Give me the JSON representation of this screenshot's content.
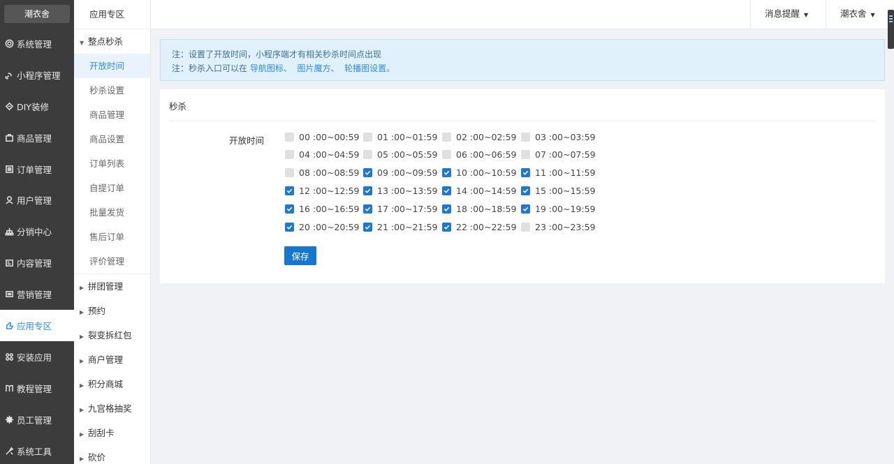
{
  "brand": "潮衣舍",
  "left_nav": [
    {
      "label": "系统管理",
      "icon": "gear-icon",
      "active": false
    },
    {
      "label": "小程序管理",
      "icon": "link-icon",
      "active": false
    },
    {
      "label": "DIY装修",
      "icon": "brush-icon",
      "active": false
    },
    {
      "label": "商品管理",
      "icon": "bag-icon",
      "active": false
    },
    {
      "label": "订单管理",
      "icon": "list-icon",
      "active": false
    },
    {
      "label": "用户管理",
      "icon": "user-icon",
      "active": false
    },
    {
      "label": "分销中心",
      "icon": "tree-icon",
      "active": false
    },
    {
      "label": "内容管理",
      "icon": "doc-icon",
      "active": false
    },
    {
      "label": "营销管理",
      "icon": "ticket-icon",
      "active": false
    },
    {
      "label": "应用专区",
      "icon": "hand-icon",
      "active": true
    },
    {
      "label": "安装应用",
      "icon": "grid-icon",
      "active": false
    },
    {
      "label": "教程管理",
      "icon": "book-icon",
      "active": false
    },
    {
      "label": "员工管理",
      "icon": "cog-icon",
      "active": false
    },
    {
      "label": "系统工具",
      "icon": "tool-icon",
      "active": false
    }
  ],
  "sub_nav": {
    "title": "应用专区",
    "open_group": "整点秒杀",
    "open_items": [
      {
        "label": "开放时间",
        "active": true
      },
      {
        "label": "秒杀设置",
        "active": false
      },
      {
        "label": "商品管理",
        "active": false
      },
      {
        "label": "商品设置",
        "active": false
      },
      {
        "label": "订单列表",
        "active": false
      },
      {
        "label": "自提订单",
        "active": false
      },
      {
        "label": "批量发货",
        "active": false
      },
      {
        "label": "售后订单",
        "active": false
      },
      {
        "label": "评价管理",
        "active": false
      }
    ],
    "collapsed_groups": [
      "拼团管理",
      "预约",
      "裂变拆红包",
      "商户管理",
      "积分商城",
      "九宫格抽奖",
      "刮刮卡",
      "砍价"
    ]
  },
  "header": {
    "messages": "消息提醒",
    "user": "潮衣舍"
  },
  "notice": {
    "line1": "注：设置了开放时间，小程序端才有相关秒杀时间点出现",
    "line2_prefix": "注：秒杀入口可以在 ",
    "link1": "导航图标、",
    "link2": "图片魔方、",
    "link3": "轮播图设置。"
  },
  "panel": {
    "title": "秒杀",
    "field_label": "开放时间",
    "save": "保存"
  },
  "slots": [
    {
      "label": "00 :00~00:59",
      "checked": false
    },
    {
      "label": "01 :00~01:59",
      "checked": false
    },
    {
      "label": "02 :00~02:59",
      "checked": false
    },
    {
      "label": "03 :00~03:59",
      "checked": false
    },
    {
      "label": "04 :00~04:59",
      "checked": false
    },
    {
      "label": "05 :00~05:59",
      "checked": false
    },
    {
      "label": "06 :00~06:59",
      "checked": false
    },
    {
      "label": "07 :00~07:59",
      "checked": false
    },
    {
      "label": "08 :00~08:59",
      "checked": false
    },
    {
      "label": "09 :00~09:59",
      "checked": true
    },
    {
      "label": "10 :00~10:59",
      "checked": true
    },
    {
      "label": "11 :00~11:59",
      "checked": true
    },
    {
      "label": "12 :00~12:59",
      "checked": true
    },
    {
      "label": "13 :00~13:59",
      "checked": true
    },
    {
      "label": "14 :00~14:59",
      "checked": true
    },
    {
      "label": "15 :00~15:59",
      "checked": true
    },
    {
      "label": "16 :00~16:59",
      "checked": true
    },
    {
      "label": "17 :00~17:59",
      "checked": true
    },
    {
      "label": "18 :00~18:59",
      "checked": true
    },
    {
      "label": "19 :00~19:59",
      "checked": true
    },
    {
      "label": "20 :00~20:59",
      "checked": true
    },
    {
      "label": "21 :00~21:59",
      "checked": true
    },
    {
      "label": "22 :00~22:59",
      "checked": true
    },
    {
      "label": "23 :00~23:59",
      "checked": false
    }
  ],
  "colors": {
    "accent": "#2d8cf0",
    "sidebar_bg": "#3c3c3c",
    "checkbox_on": "#1e78d2",
    "notice_bg": "#e1f1fb"
  }
}
